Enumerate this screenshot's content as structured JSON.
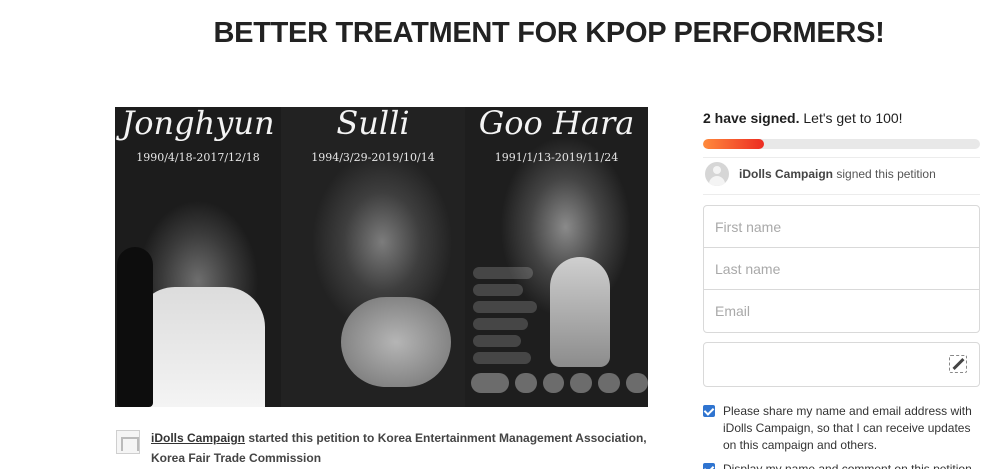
{
  "page": {
    "title": "BETTER TREATMENT FOR KPOP PERFORMERS!"
  },
  "hero": {
    "panels": [
      {
        "name": "Jonghyun",
        "dates": "1990/4/18-2017/12/18"
      },
      {
        "name": "Sulli",
        "dates": "1994/3/29-2019/10/14"
      },
      {
        "name": "Goo Hara",
        "dates": "1991/1/13-2019/11/24"
      }
    ]
  },
  "starter": {
    "organizer": "iDolls Campaign",
    "text": "started this petition to Korea Entertainment Management Association, Korea Fair Trade Commission"
  },
  "progress": {
    "signed_count_text": "2 have signed.",
    "goal_text": "Let's get to 100!",
    "signed": 2,
    "goal": 100,
    "bar_fill_fraction": 0.22,
    "colors": {
      "start": "#ff8a3c",
      "end": "#ec2c22"
    }
  },
  "recent_signer": {
    "name": "iDolls Campaign",
    "action": "signed this petition"
  },
  "form": {
    "first_name_placeholder": "First name",
    "last_name_placeholder": "Last name",
    "email_placeholder": "Email",
    "comment_icon": "edit-icon"
  },
  "options": {
    "share_label": "Please share my name and email address with iDolls Campaign, so that I can receive updates on this campaign and others.",
    "display_label": "Display my name and comment on this petition"
  }
}
